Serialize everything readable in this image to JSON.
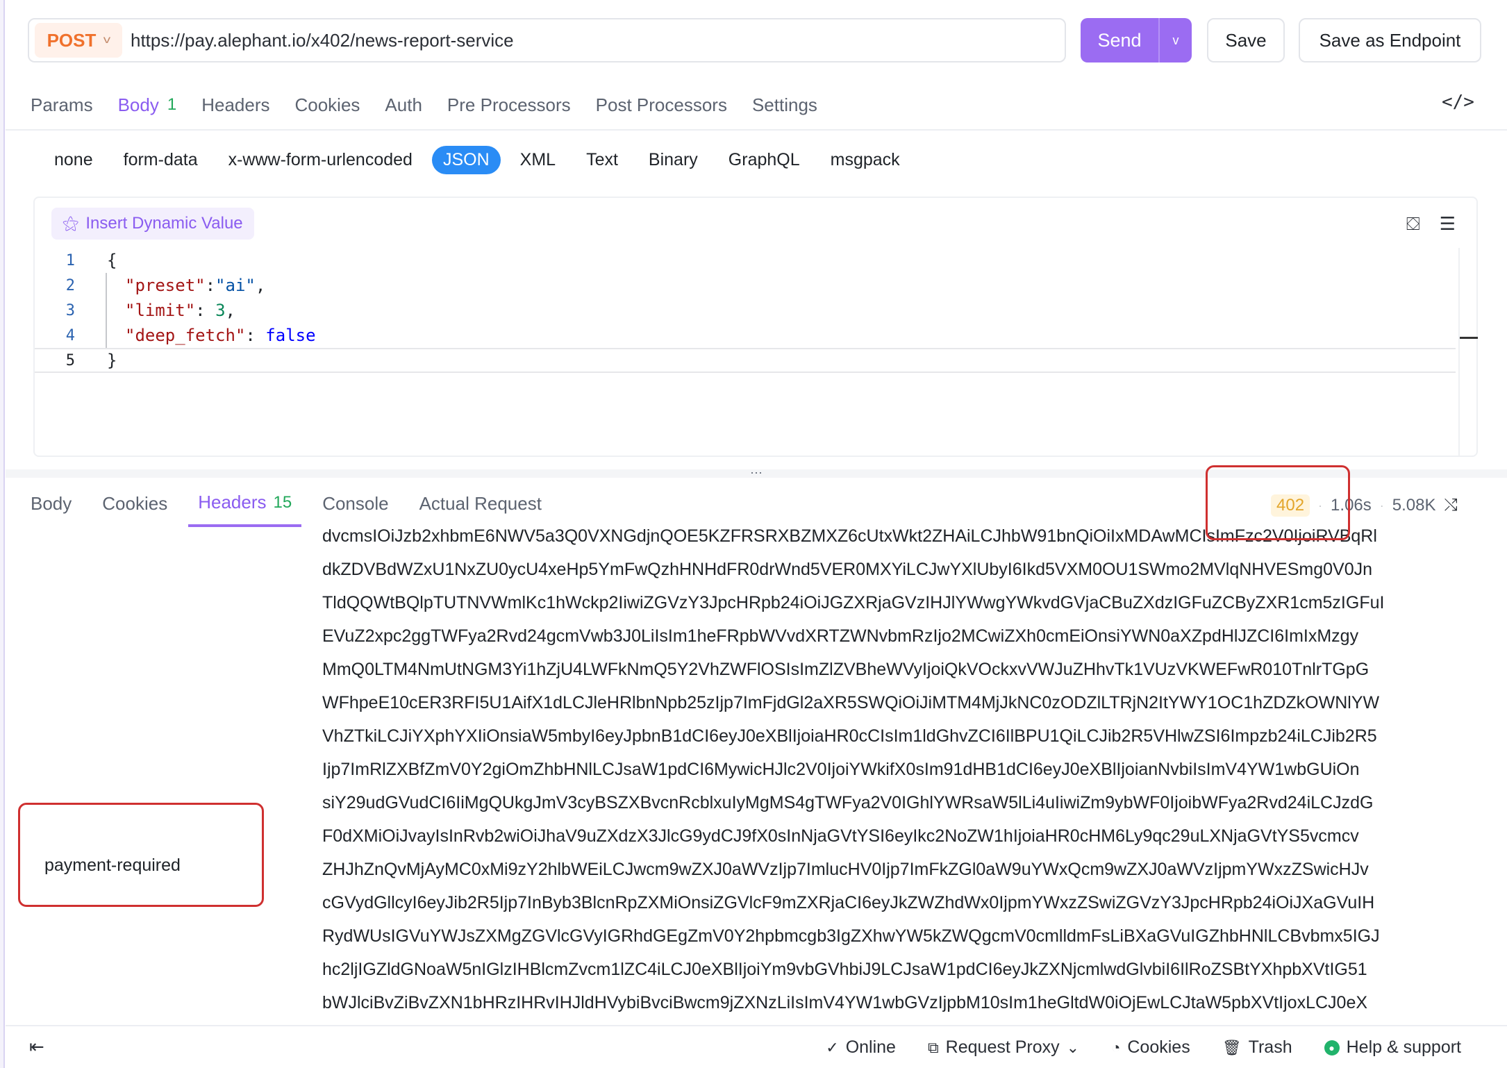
{
  "request": {
    "method": "POST",
    "url": "https://pay.alephant.io/x402/news-report-service",
    "send_label": "Send",
    "save_label": "Save",
    "save_endpoint_label": "Save as Endpoint"
  },
  "request_tabs": [
    {
      "label": "Params"
    },
    {
      "label": "Body",
      "count": "1"
    },
    {
      "label": "Headers"
    },
    {
      "label": "Cookies"
    },
    {
      "label": "Auth"
    },
    {
      "label": "Pre Processors"
    },
    {
      "label": "Post Processors"
    },
    {
      "label": "Settings"
    }
  ],
  "body_types": [
    "none",
    "form-data",
    "x-www-form-urlencoded",
    "JSON",
    "XML",
    "Text",
    "Binary",
    "GraphQL",
    "msgpack"
  ],
  "editor": {
    "dynamic_value_label": "Insert Dynamic Value",
    "lines": [
      "1",
      "2",
      "3",
      "4",
      "5"
    ],
    "brace_open": "{",
    "brace_close": "}",
    "fields": [
      {
        "key": "\"preset\"",
        "sep": ":",
        "value": "\"ai\"",
        "tail": ","
      },
      {
        "key": "\"limit\"",
        "sep": ": ",
        "value": "3",
        "tail": ","
      },
      {
        "key": "\"deep_fetch\"",
        "sep": ": ",
        "value": "false",
        "tail": ""
      }
    ]
  },
  "response_tabs": [
    {
      "label": "Body"
    },
    {
      "label": "Cookies"
    },
    {
      "label": "Headers",
      "count": "15"
    },
    {
      "label": "Console"
    },
    {
      "label": "Actual Request"
    }
  ],
  "response_meta": {
    "status": "402",
    "time": "1.06s",
    "size": "5.08K"
  },
  "header_row": {
    "key": "payment-required",
    "value_lines": [
      "dvcmsIOiJzb2xhbmE6NWV5a3Q0VXNGdjnQOE5KZFRSRXBZMXZ6cUtxWkt2ZHAiLCJhbW91bnQiOiIxMDAwMCIsImFzc2V0IjoiRVBqRl",
      "dkZDVBdWZxU1NxZU0ycU4xeHp5YmFwQzhHNHdFR0drWnd5VER0MXYiLCJwYXlUbyI6Ikd5VXM0OU1SWmo2MVlqNHVESmg0V0Jn",
      "TldQQWtBQlpTUTNVWmlKc1hWckp2IiwiZGVzY3JpcHRpb24iOiJGZXRjaGVzIHJlYWwgYWkvdGVjaCBuZXdzIGFuZCByZXR1cm5zIGFuI",
      "EVuZ2xpc2ggTWFya2Rvd24gcmVwb3J0LiIsIm1heFRpbWVvdXRTZWNvbmRzIjo2MCwiZXh0cmEiOnsiYWN0aXZpdHlJZCI6ImIxMzgy",
      "MmQ0LTM4NmUtNGM3Yi1hZjU4LWFkNmQ5Y2VhZWFlOSIsImZlZVBheWVyIjoiQkVOckxvVWJuZHhvTk1VUzVKWEFwR010TnlrTGpG",
      "WFhpeE10cER3RFI5U1AifX1dLCJleHRlbnNpb25zIjp7ImFjdGl2aXR5SWQiOiJiMTM4MjJkNC0zODZlLTRjN2ItYWY1OC1hZDZkOWNlYW",
      "VhZTkiLCJiYXphYXIiOnsiaW5mbyI6eyJpbnB1dCI6eyJ0eXBlIjoiaHR0cCIsIm1ldGhvZCI6IlBPU1QiLCJib2R5VHlwZSI6Impzb24iLCJib2R5",
      "Ijp7ImRlZXBfZmV0Y2giOmZhbHNlLCJsaW1pdCI6MywicHJlc2V0IjoiYWkifX0sIm91dHB1dCI6eyJ0eXBlIjoianNvbiIsImV4YW1wbGUiOn",
      "siY29udGVudCI6IiMgQUkgJmV3cyBSZXBvcnRcblxuIyMgMS4gTWFya2V0IGhlYWRsaW5lLi4uIiwiZm9ybWF0IjoibWFya2Rvd24iLCJzdG",
      "F0dXMiOiJvayIsInRvb2wiOiJhaV9uZXdzX3JlcG9ydCJ9fX0sInNjaGVtYSI6eyIkc2NoZW1hIjoiaHR0cHM6Ly9qc29uLXNjaGVtYS5vcmcv",
      "ZHJhZnQvMjAyMC0xMi9zY2hlbWEiLCJwcm9wZXJ0aWVzIjp7ImlucHV0Ijp7ImFkZGl0aW9uYWxQcm9wZXJ0aWVzIjpmYWxzZSwicHJv",
      "cGVydGllcyI6eyJib2R5Ijp7InByb3BlcnRpZXMiOnsiZGVlcF9mZXRjaCI6eyJkZWZhdWx0IjpmYWxzZSwiZGVzY3JpcHRpb24iOiJXaGVuIH",
      "RydWUsIGVuYWJsZXMgZGVlcGVyIGRhdGEgZmV0Y2hpbmcgb3IgZXhwYW5kZWQgcmV0cmlldmFsLiBXaGVuIGZhbHNlLCBvbmx5IGJ",
      "hc2ljIGZldGNoaW5nIGlzIHBlcmZvcm1lZC4iLCJ0eXBlIjoiYm9vbGVhbiJ9LCJsaW1pdCI6eyJkZXNjcmlwdGlvbiI6IlRoZSBtYXhpbXVtIG51",
      "bWJlciBvZiBvZXN1bHRzIHRvIHJldHVybiBvciBwcm9jZXNzLiIsImV4YW1wbGVzIjpbM10sIm1heGltdW0iOjEwLCJtaW5pbXVtIjoxLCJ0eX"
    ]
  },
  "footer": {
    "online": "Online",
    "request_proxy": "Request Proxy",
    "cookies": "Cookies",
    "trash": "Trash",
    "help": "Help & support"
  },
  "colors": {
    "accent": "#9b6cf2",
    "method": "#f0712c",
    "json_selected": "#2a8cf5",
    "status_402": "#e3a52a",
    "annotation_box": "#cf3030"
  }
}
